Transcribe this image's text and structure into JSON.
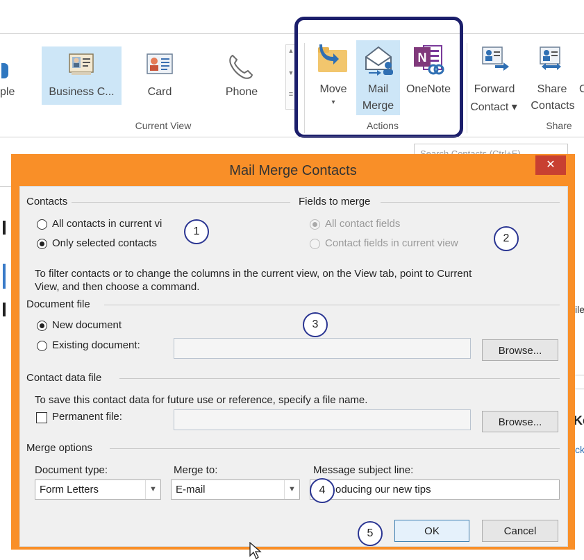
{
  "ribbon": {
    "partial_left_label": "ple",
    "current_view": {
      "items": [
        {
          "label": "Business C..."
        },
        {
          "label": "Card"
        },
        {
          "label": "Phone"
        }
      ],
      "group_label": "Current View"
    },
    "actions": {
      "move_label": "Move",
      "move_arrow": "▾",
      "mail_merge_line1": "Mail",
      "mail_merge_line2": "Merge",
      "onenote_label": "OneNote",
      "group_label": "Actions"
    },
    "share": {
      "forward_line1": "Forward",
      "forward_line2": "Contact ▾",
      "share_line1": "Share",
      "share_line2": "Contacts",
      "group_label": "Share"
    },
    "search_placeholder": "Search Contacts (Ctrl+E)"
  },
  "background_fragments": {
    "right_file": "ile",
    "right_ke": "Ke",
    "right_ck": "ck"
  },
  "dialog": {
    "title": "Mail Merge Contacts",
    "close_glyph": "✕",
    "contacts": {
      "heading": "Contacts",
      "option_all": "All contacts in current vi",
      "option_selected": "Only selected contacts",
      "selected": "Only selected contacts"
    },
    "fields_to_merge": {
      "heading": "Fields to merge",
      "option_all": "All contact fields",
      "option_view": "Contact fields in current view",
      "selected": "All contact fields"
    },
    "filter_help_line1": "To filter contacts or to change the columns in the current view, on the View tab, point to Current",
    "filter_help_line2": "View, and then choose a command.",
    "document_file": {
      "heading": "Document file",
      "option_new": "New document",
      "option_existing": "Existing document:",
      "existing_value": "",
      "browse": "Browse..."
    },
    "contact_data_file": {
      "heading": "Contact data file",
      "help": "To save this contact data for future use or reference, specify a file name.",
      "permanent_label": "Permanent file:",
      "permanent_checked": false,
      "permanent_value": "",
      "browse": "Browse..."
    },
    "merge_options": {
      "heading": "Merge options",
      "document_type_label": "Document type:",
      "document_type_value": "Form Letters",
      "merge_to_label": "Merge to:",
      "merge_to_value": "E-mail",
      "subject_label": "Message subject line:",
      "subject_value": "oducing our new tips"
    },
    "ok": "OK",
    "cancel": "Cancel"
  },
  "callouts": [
    "1",
    "2",
    "3",
    "4",
    "5"
  ],
  "colors": {
    "dialog_border": "#f98f28",
    "highlight_border": "#1b1e6b",
    "callout_border": "#2a3592",
    "selected_ribbon_item": "#cde6f7",
    "close_button": "#c84031"
  },
  "icons": [
    "contact-card-icon",
    "card-icon",
    "phone-icon",
    "move-folder-icon",
    "mail-merge-icon",
    "onenote-icon",
    "forward-contact-icon",
    "share-contacts-icon",
    "close-icon",
    "dropdown-arrow-icon",
    "mouse-cursor-icon"
  ]
}
